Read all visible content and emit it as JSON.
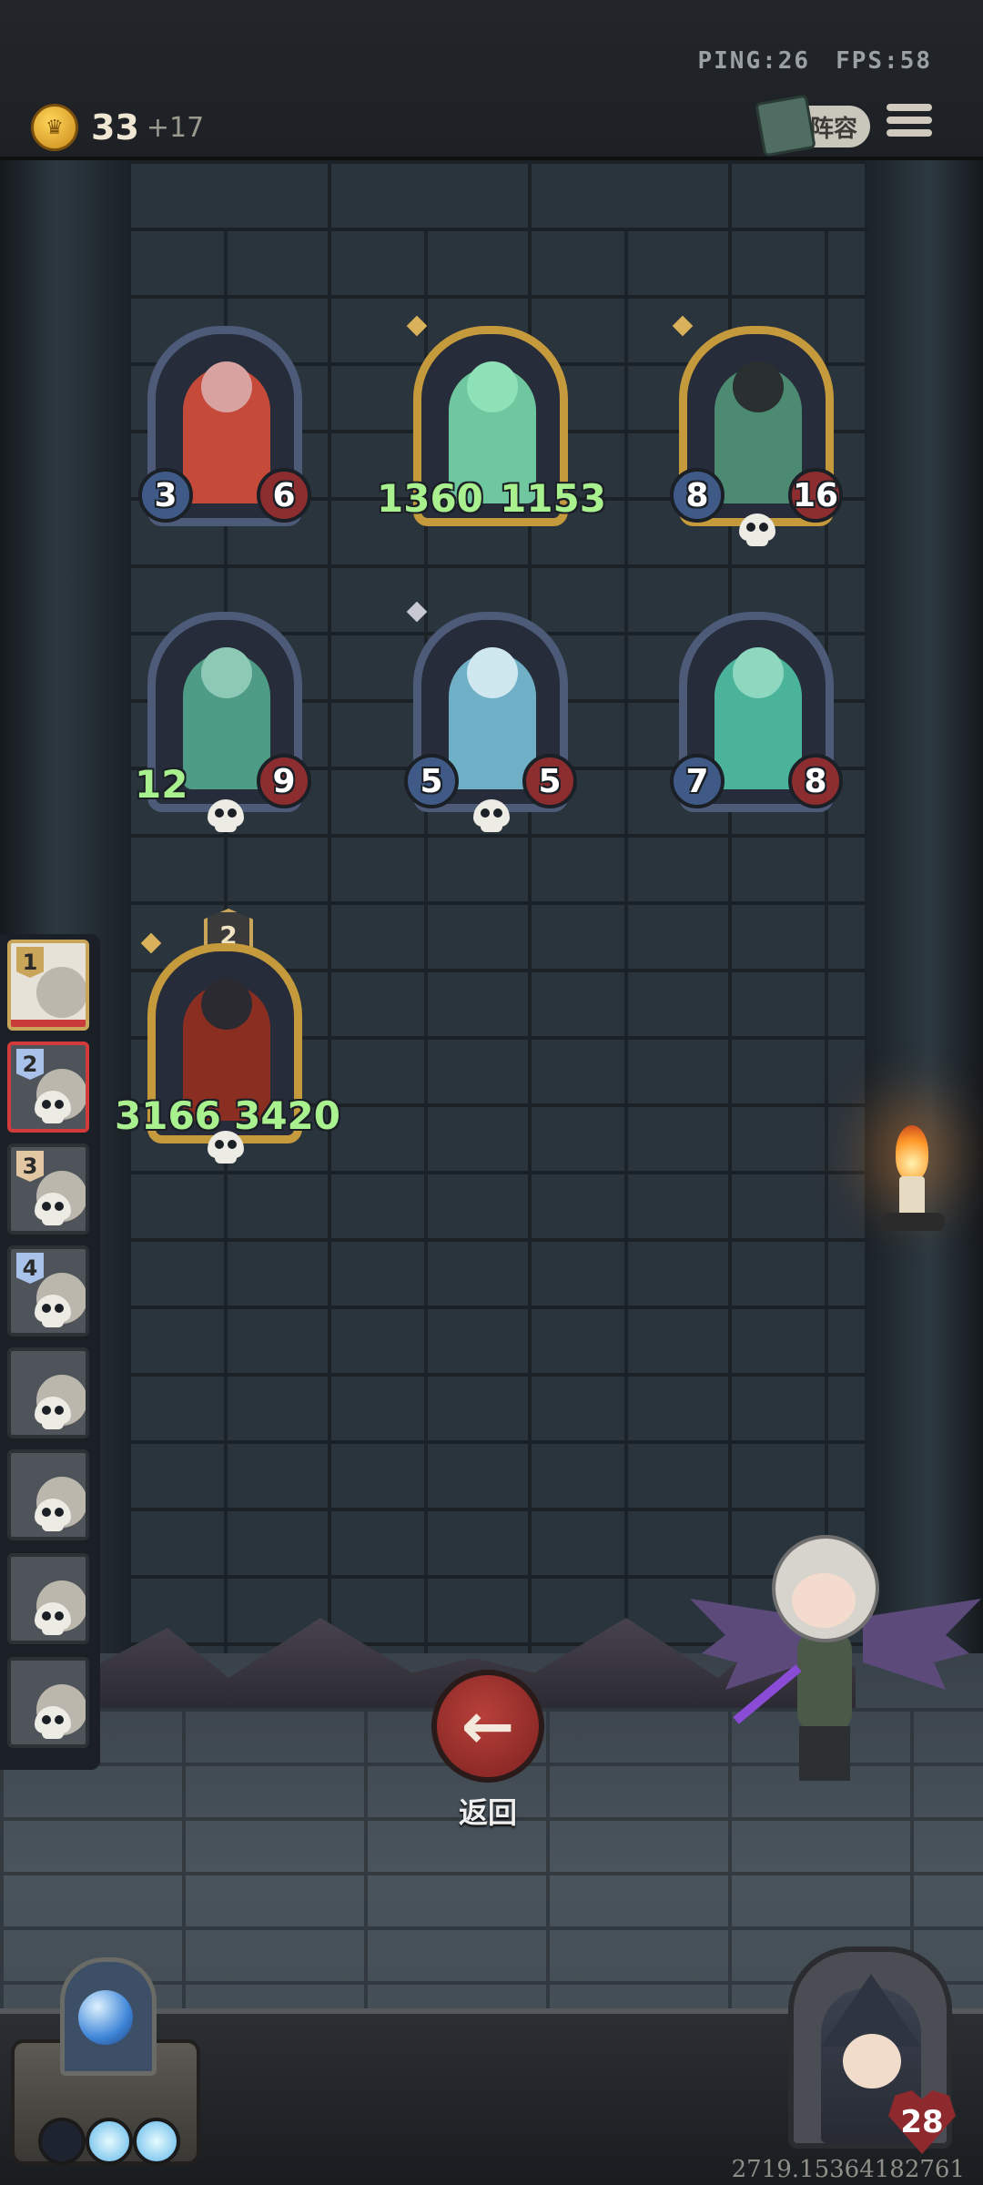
{
  "status": {
    "ping": "PING:26",
    "fps": "FPS:58"
  },
  "gold": {
    "amount": "33",
    "income": "+17"
  },
  "lineup_button": {
    "label": "阵容"
  },
  "units": [
    {
      "atk": "3",
      "hp": "6",
      "tint": "#c64a3a",
      "skin": "#d7a2a0"
    },
    {
      "atk": "1360",
      "hp": "1153",
      "tint": "#6fc7a0",
      "skin": "#8fe1b8"
    },
    {
      "atk": "8",
      "hp": "16",
      "tint": "#4c8a72",
      "skin": "#2a2f30"
    },
    {
      "atk": "12",
      "hp": "9",
      "tint": "#4f9c86",
      "skin": "#8ec9b6"
    },
    {
      "atk": "5",
      "hp": "5",
      "tint": "#6fb0c6",
      "skin": "#cfe8ef"
    },
    {
      "atk": "7",
      "hp": "8",
      "tint": "#4ab39a",
      "skin": "#8fd8c0"
    },
    {
      "atk": "3166",
      "hp": "3420",
      "tint": "#8b2e22",
      "skin": "#2a2a30",
      "level": "2"
    }
  ],
  "queue": [
    {
      "num": "1"
    },
    {
      "num": "2"
    },
    {
      "num": "3"
    },
    {
      "num": "4"
    }
  ],
  "back_button": {
    "label": "返回"
  },
  "player": {
    "health": "28"
  },
  "coords_readout": "2719.15364182761",
  "colors": {
    "accent_gold": "#c9a559",
    "hp_red": "#8c2d2f",
    "atk_blue": "#3f5a86",
    "buff_green": "#a9f08e"
  },
  "icons": [
    "coin-icon",
    "book-icon",
    "menu-icon",
    "skull-icon",
    "arrow-left-icon",
    "orb-icon",
    "heart-icon"
  ]
}
